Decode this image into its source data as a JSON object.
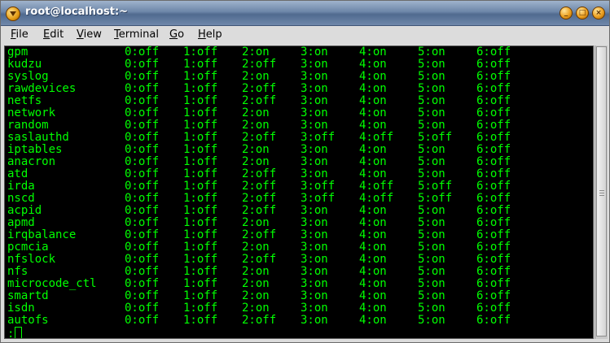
{
  "window": {
    "title": "root@localhost:~",
    "buttons": {
      "minimize": "_",
      "maximize": "□",
      "close": "×"
    }
  },
  "menu": [
    {
      "first": "F",
      "rest": "ile"
    },
    {
      "first": "E",
      "rest": "dit"
    },
    {
      "first": "V",
      "rest": "iew"
    },
    {
      "first": "T",
      "rest": "erminal"
    },
    {
      "first": "G",
      "rest": "o"
    },
    {
      "first": "H",
      "rest": "elp"
    }
  ],
  "terminal": {
    "text_color": "#00ff00",
    "background": "#000000",
    "rows": [
      [
        "gpm",
        "0:off",
        "1:off",
        "2:on",
        "3:on",
        "4:on",
        "5:on",
        "6:off"
      ],
      [
        "kudzu",
        "0:off",
        "1:off",
        "2:off",
        "3:on",
        "4:on",
        "5:on",
        "6:off"
      ],
      [
        "syslog",
        "0:off",
        "1:off",
        "2:on",
        "3:on",
        "4:on",
        "5:on",
        "6:off"
      ],
      [
        "rawdevices",
        "0:off",
        "1:off",
        "2:off",
        "3:on",
        "4:on",
        "5:on",
        "6:off"
      ],
      [
        "netfs",
        "0:off",
        "1:off",
        "2:off",
        "3:on",
        "4:on",
        "5:on",
        "6:off"
      ],
      [
        "network",
        "0:off",
        "1:off",
        "2:on",
        "3:on",
        "4:on",
        "5:on",
        "6:off"
      ],
      [
        "random",
        "0:off",
        "1:off",
        "2:on",
        "3:on",
        "4:on",
        "5:on",
        "6:off"
      ],
      [
        "saslauthd",
        "0:off",
        "1:off",
        "2:off",
        "3:off",
        "4:off",
        "5:off",
        "6:off"
      ],
      [
        "iptables",
        "0:off",
        "1:off",
        "2:on",
        "3:on",
        "4:on",
        "5:on",
        "6:off"
      ],
      [
        "anacron",
        "0:off",
        "1:off",
        "2:on",
        "3:on",
        "4:on",
        "5:on",
        "6:off"
      ],
      [
        "atd",
        "0:off",
        "1:off",
        "2:off",
        "3:on",
        "4:on",
        "5:on",
        "6:off"
      ],
      [
        "irda",
        "0:off",
        "1:off",
        "2:off",
        "3:off",
        "4:off",
        "5:off",
        "6:off"
      ],
      [
        "nscd",
        "0:off",
        "1:off",
        "2:off",
        "3:off",
        "4:off",
        "5:off",
        "6:off"
      ],
      [
        "acpid",
        "0:off",
        "1:off",
        "2:off",
        "3:on",
        "4:on",
        "5:on",
        "6:off"
      ],
      [
        "apmd",
        "0:off",
        "1:off",
        "2:on",
        "3:on",
        "4:on",
        "5:on",
        "6:off"
      ],
      [
        "irqbalance",
        "0:off",
        "1:off",
        "2:off",
        "3:on",
        "4:on",
        "5:on",
        "6:off"
      ],
      [
        "pcmcia",
        "0:off",
        "1:off",
        "2:on",
        "3:on",
        "4:on",
        "5:on",
        "6:off"
      ],
      [
        "nfslock",
        "0:off",
        "1:off",
        "2:off",
        "3:on",
        "4:on",
        "5:on",
        "6:off"
      ],
      [
        "nfs",
        "0:off",
        "1:off",
        "2:on",
        "3:on",
        "4:on",
        "5:on",
        "6:off"
      ],
      [
        "microcode_ctl",
        "0:off",
        "1:off",
        "2:on",
        "3:on",
        "4:on",
        "5:on",
        "6:off"
      ],
      [
        "smartd",
        "0:off",
        "1:off",
        "2:on",
        "3:on",
        "4:on",
        "5:on",
        "6:off"
      ],
      [
        "isdn",
        "0:off",
        "1:off",
        "2:on",
        "3:on",
        "4:on",
        "5:on",
        "6:off"
      ],
      [
        "autofs",
        "0:off",
        "1:off",
        "2:off",
        "3:on",
        "4:on",
        "5:on",
        "6:off"
      ]
    ],
    "prompt": ":"
  }
}
